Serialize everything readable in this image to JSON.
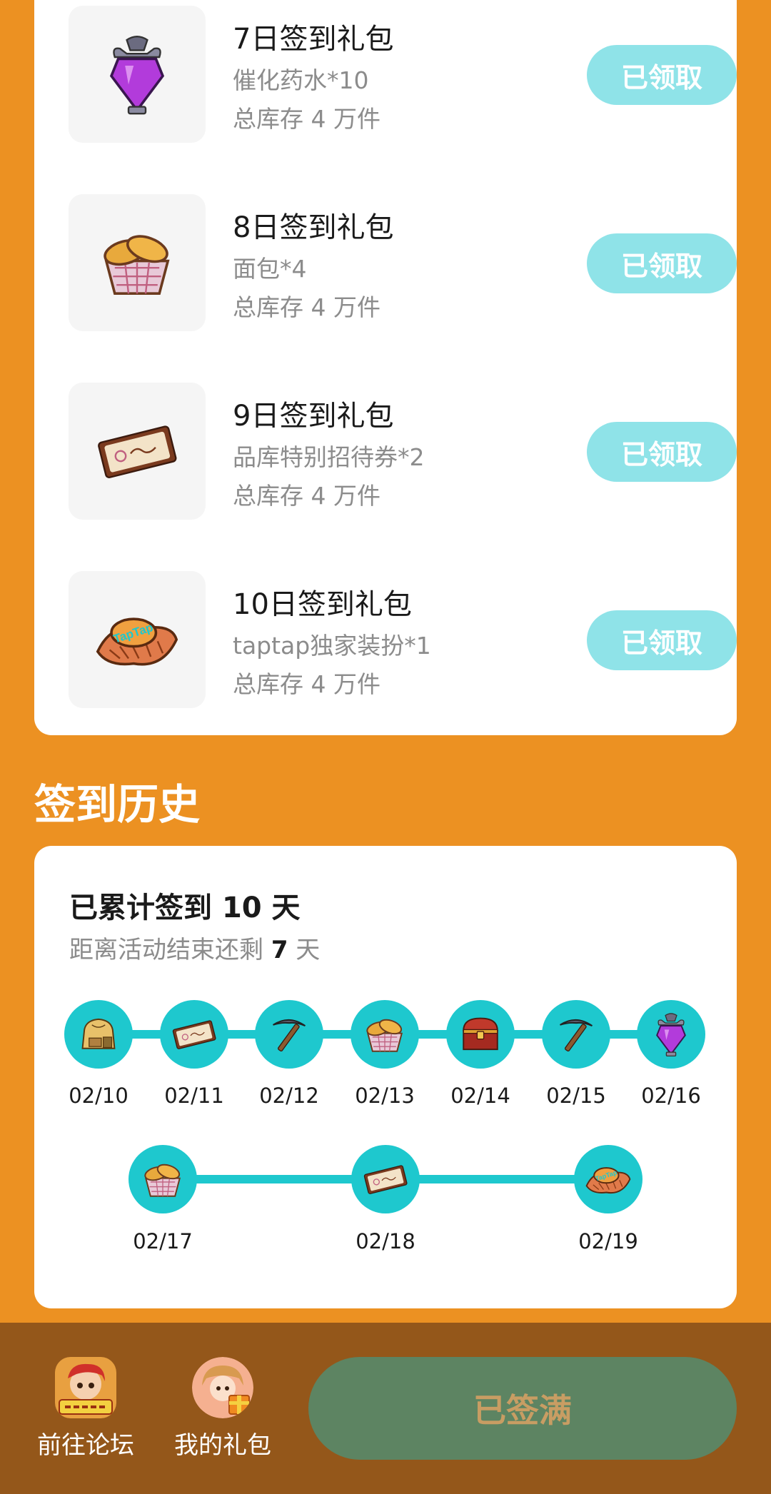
{
  "gifts": [
    {
      "title": "7日签到礼包",
      "item": "催化药水*10",
      "stock": "总库存 4 万件",
      "button": "已领取",
      "icon": "potion-icon"
    },
    {
      "title": "8日签到礼包",
      "item": "面包*4",
      "stock": "总库存 4 万件",
      "button": "已领取",
      "icon": "bread-basket-icon"
    },
    {
      "title": "9日签到礼包",
      "item": "品库特别招待券*2",
      "stock": "总库存 4 万件",
      "button": "已领取",
      "icon": "ticket-icon"
    },
    {
      "title": "10日签到礼包",
      "item": "taptap独家装扮*1",
      "stock": "总库存 4 万件",
      "button": "已领取",
      "icon": "taptap-wing-hat-icon"
    }
  ],
  "history": {
    "section_title": "签到历史",
    "total_prefix": "已累计签到 ",
    "total_days": "10",
    "total_suffix": " 天",
    "remaining_prefix": "距离活动结束还剩 ",
    "remaining_days": "7",
    "remaining_suffix": " 天",
    "days": [
      {
        "date": "02/10",
        "icon": "bag-icon"
      },
      {
        "date": "02/11",
        "icon": "ticket-icon"
      },
      {
        "date": "02/12",
        "icon": "pickaxe-icon"
      },
      {
        "date": "02/13",
        "icon": "bread-basket-icon"
      },
      {
        "date": "02/14",
        "icon": "treasure-chest-icon"
      },
      {
        "date": "02/15",
        "icon": "pickaxe-icon"
      },
      {
        "date": "02/16",
        "icon": "potion-icon"
      },
      {
        "date": "02/17",
        "icon": "bread-basket-icon"
      },
      {
        "date": "02/18",
        "icon": "ticket-icon"
      },
      {
        "date": "02/19",
        "icon": "taptap-wing-hat-icon"
      }
    ]
  },
  "bottom_bar": {
    "forum_label": "前往论坛",
    "gifts_label": "我的礼包",
    "main_button": "已签满"
  },
  "colors": {
    "background": "#EC9122",
    "teal": "#1EC8CE",
    "claimed_button": "#8FE3E8",
    "bottom_bar": "#94571A",
    "main_button": "#5D8462"
  }
}
